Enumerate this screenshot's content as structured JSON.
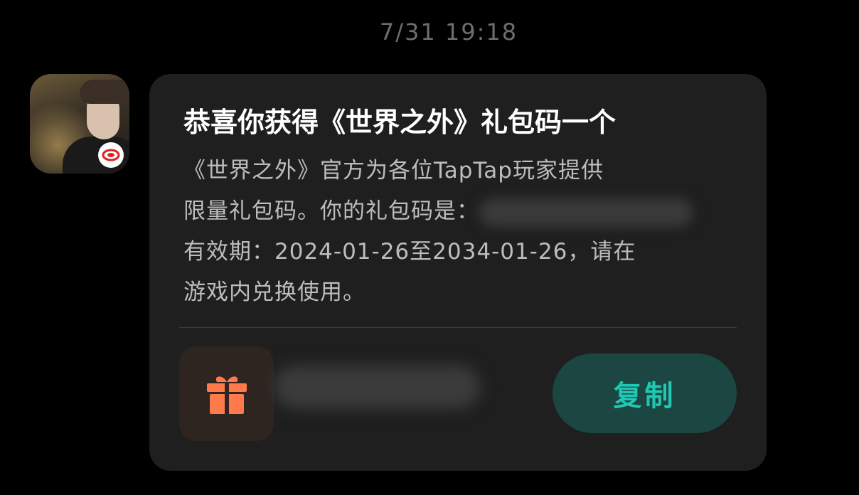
{
  "header": {
    "timestamp": "7/31  19:18"
  },
  "sender": {
    "avatar_icon": "game-avatar-icon",
    "publisher_badge_icon": "netease-logo-icon"
  },
  "card": {
    "title": "恭喜你获得《世界之外》礼包码一个",
    "body_line1": "《世界之外》官方为各位TapTap玩家提供",
    "body_line2_prefix": "限量礼包码。你的礼包码是：",
    "body_line3": "有效期：2024-01-26至2034-01-26，请在",
    "body_line4": "游戏内兑换使用。",
    "gift_icon": "gift-icon",
    "copy_label": "复制"
  },
  "colors": {
    "background": "#000000",
    "card": "#1f1f1f",
    "accent": "#20c7b3",
    "copy_button_bg": "#1b4641",
    "gift_orange": "#ff7a4a",
    "gift_tile_bg": "#2e2420"
  }
}
